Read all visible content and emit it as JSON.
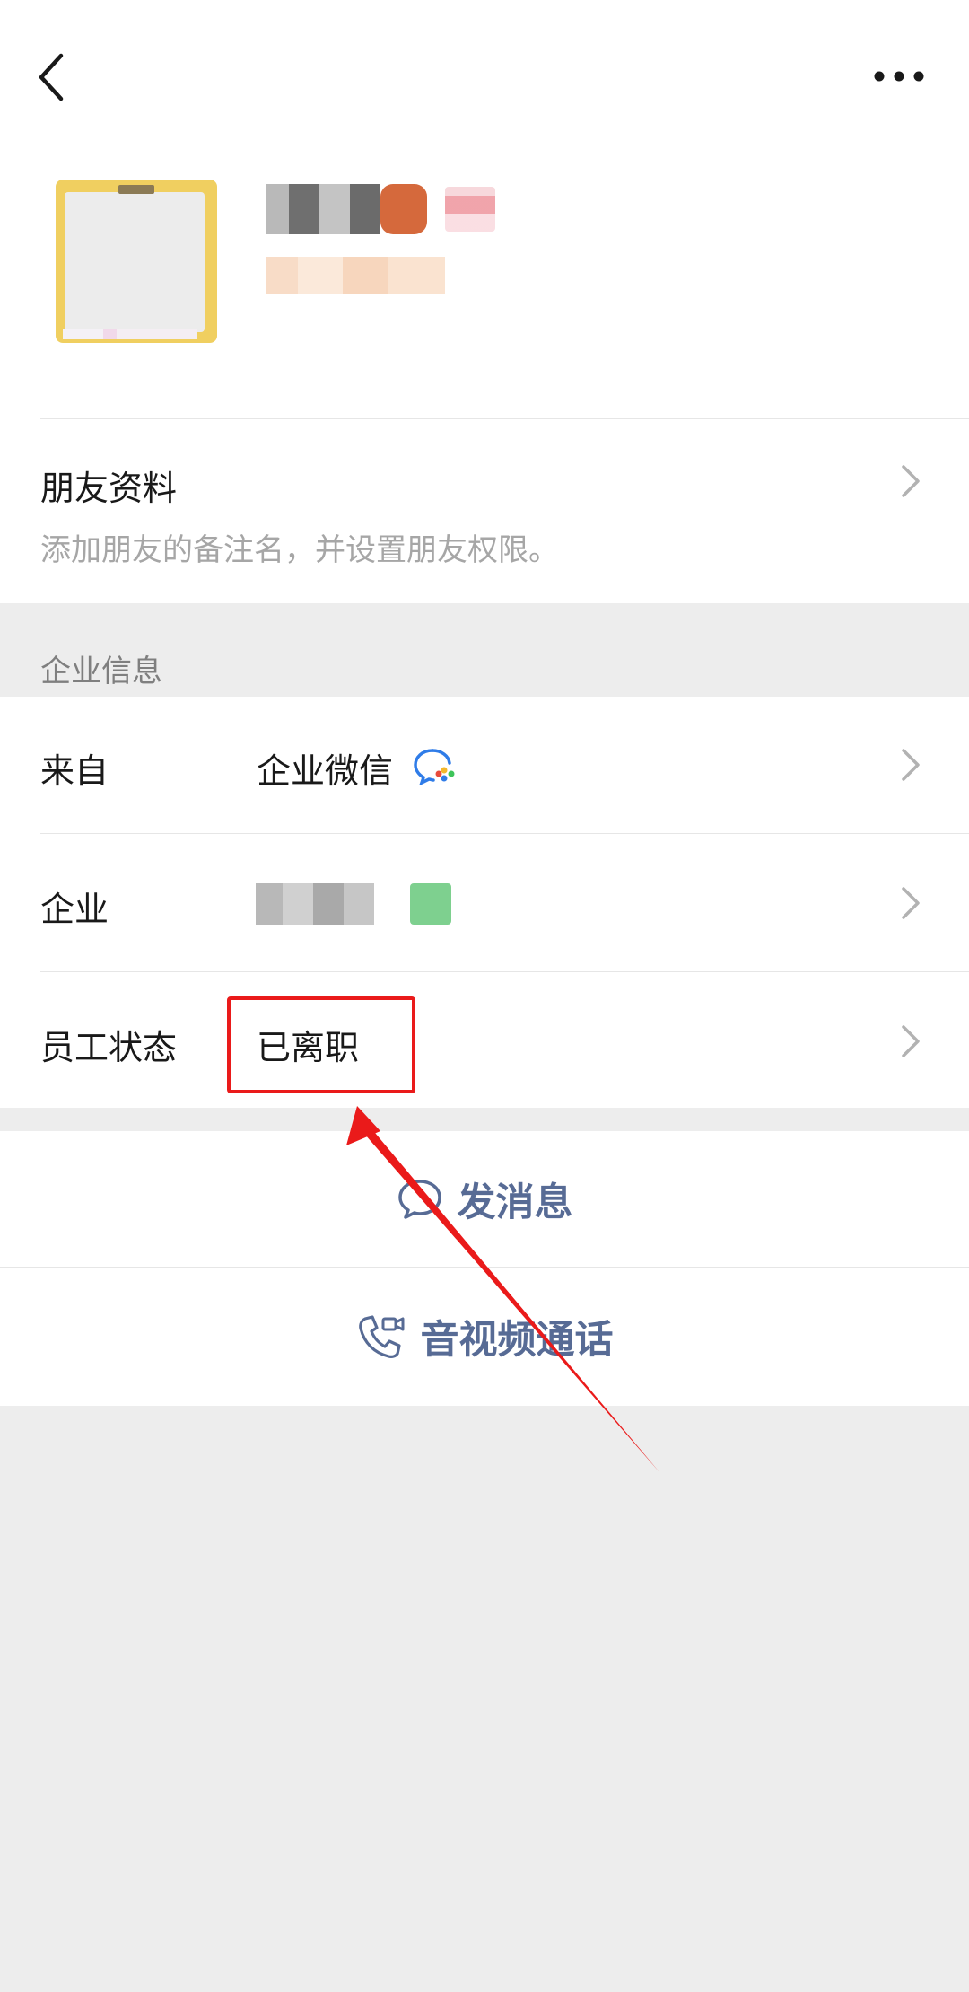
{
  "friend_profile": {
    "title": "朋友资料",
    "subtitle": "添加朋友的备注名，并设置朋友权限。"
  },
  "enterprise_section": {
    "label": "企业信息",
    "from_label": "来自",
    "from_value": "企业微信",
    "company_label": "企业",
    "status_label": "员工状态",
    "status_value": "已离职"
  },
  "actions": {
    "message": "发消息",
    "call": "音视频通话"
  },
  "colors": {
    "link": "#576b95",
    "highlight": "#ea1a1a",
    "background": "#ededed"
  },
  "icons": [
    "back-arrow-icon",
    "more-icon",
    "chevron-right-icon",
    "wecom-icon",
    "chat-bubble-icon",
    "phone-video-icon"
  ]
}
